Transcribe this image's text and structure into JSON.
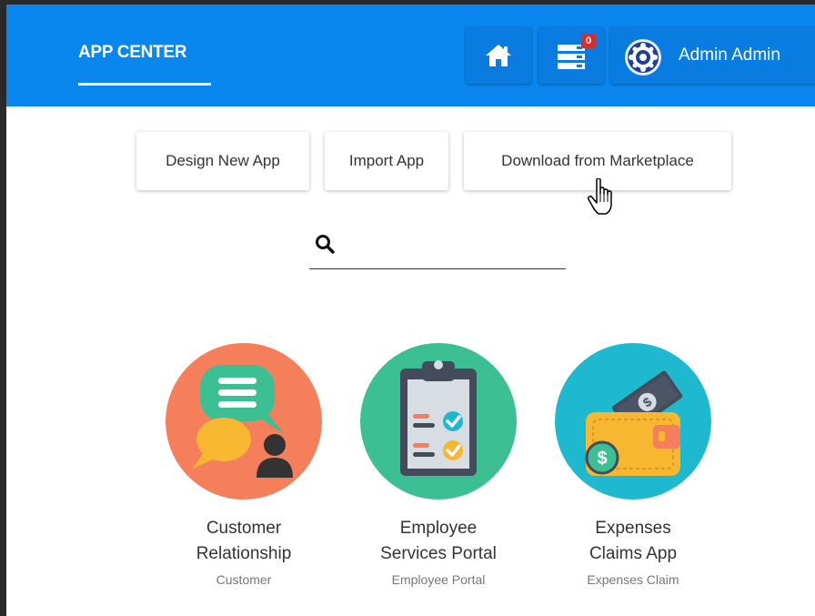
{
  "header": {
    "title": "APP CENTER",
    "notification_count": "0",
    "user_name": "Admin Admin",
    "brand_color": "#0a86ef"
  },
  "actions": {
    "design_label": "Design New App",
    "import_label": "Import App",
    "marketplace_label": "Download from Marketplace"
  },
  "search": {
    "placeholder": ""
  },
  "apps": [
    {
      "name_line1": "Customer",
      "name_line2": "Relationship",
      "subtitle": "Customer",
      "icon": "chat-bubbles-icon",
      "color": "#f47f5a"
    },
    {
      "name_line1": "Employee",
      "name_line2": "Services Portal",
      "subtitle": "Employee Portal",
      "icon": "clipboard-checklist-icon",
      "color": "#3dbf94"
    },
    {
      "name_line1": "Expenses",
      "name_line2": "Claims App",
      "subtitle": "Expenses Claim",
      "icon": "wallet-icon",
      "color": "#1eb9cf"
    }
  ]
}
